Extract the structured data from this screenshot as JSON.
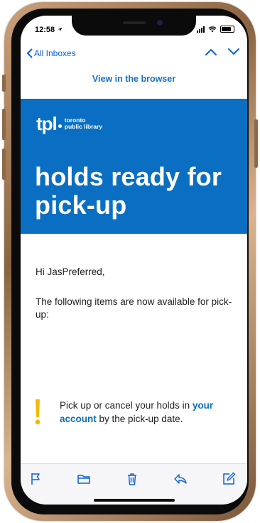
{
  "status_bar": {
    "time": "12:58"
  },
  "nav": {
    "back_label": "All Inboxes"
  },
  "email": {
    "view_in_browser": "View in the browser",
    "logo": {
      "mark": "tpl",
      "line1": "toronto",
      "line2": "public library"
    },
    "headline": "holds ready for pick-up",
    "greeting": "Hi JasPreferred,",
    "intro": "The following items are now available for pick-up:",
    "notice": {
      "before": "Pick up or cancel your holds in",
      "link": "your account",
      "after": "by the pick-up date."
    }
  },
  "toolbar": {
    "icons": [
      "flag-icon",
      "folder-icon",
      "trash-icon",
      "reply-icon",
      "compose-icon"
    ]
  },
  "colors": {
    "accent_blue": "#0a6fc2",
    "link_blue": "#1572c6",
    "ios_blue": "#0a60d8",
    "warning_yellow": "#f5b800"
  }
}
